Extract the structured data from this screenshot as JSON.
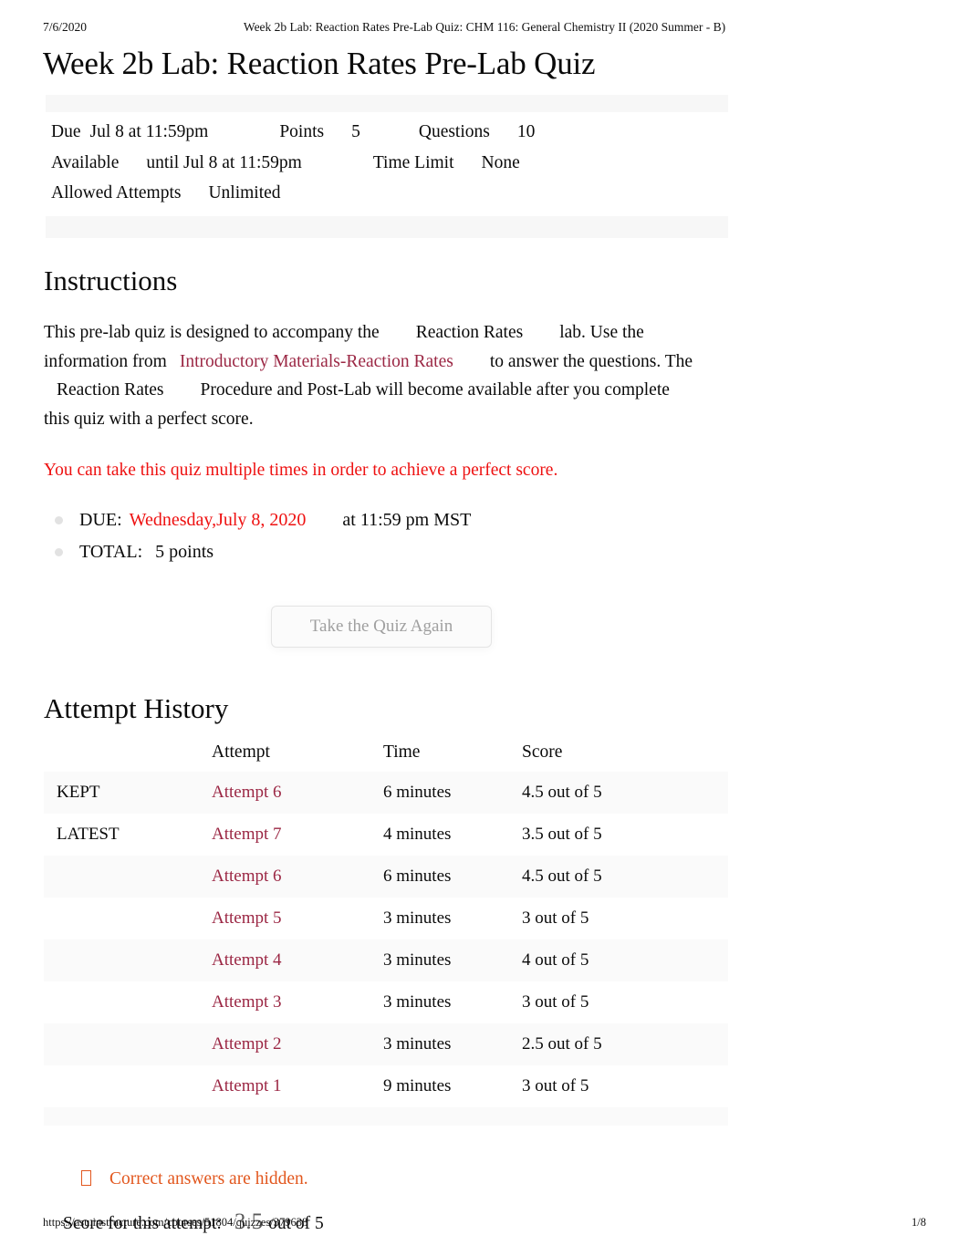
{
  "print": {
    "date": "7/6/2020",
    "header_title": "Week 2b Lab: Reaction Rates Pre-Lab Quiz: CHM 116: General Chemistry II (2020 Summer - B)",
    "url": "https://asu.instructure.com/courses/51804/quizzes/379638",
    "page_number": "1/8"
  },
  "quiz": {
    "title": "Week 2b Lab: Reaction Rates Pre-Lab Quiz",
    "meta": {
      "due_label": "Due",
      "due_value": "Jul 8 at 11:59pm",
      "points_label": "Points",
      "points_value": "5",
      "questions_label": "Questions",
      "questions_value": "10",
      "available_label": "Available",
      "available_value": "until Jul 8 at 11:59pm",
      "time_limit_label": "Time Limit",
      "time_limit_value": "None",
      "allowed_attempts_label": "Allowed Attempts",
      "allowed_attempts_value": "Unlimited"
    }
  },
  "instructions": {
    "heading": "Instructions",
    "para_part1": "This pre-lab quiz is designed to accompany the",
    "para_lab1": "Reaction Rates",
    "para_part2": "lab. Use the information from",
    "para_link": "Introductory Materials-Reaction Rates",
    "para_part3": "to answer the questions. The",
    "para_lab2": "Reaction Rates",
    "para_part4": "Procedure and Post-Lab will become available after you complete this quiz with a perfect score.",
    "red_note": "You can take this quiz multiple times in order to achieve a perfect score.",
    "bullets": [
      {
        "label": "DUE:",
        "highlight": "Wednesday,July 8, 2020",
        "tail": "at 11:59 pm MST"
      },
      {
        "label": "TOTAL:",
        "highlight": "",
        "tail": "5 points"
      }
    ]
  },
  "actions": {
    "take_quiz_again": "Take the Quiz Again"
  },
  "attempt_history": {
    "heading": "Attempt History",
    "columns": [
      "",
      "Attempt",
      "Time",
      "Score"
    ],
    "rows": [
      {
        "status": "KEPT",
        "attempt": "Attempt 6",
        "time": "6 minutes",
        "score": "4.5 out of 5"
      },
      {
        "status": "LATEST",
        "attempt": "Attempt 7",
        "time": "4 minutes",
        "score": "3.5 out of 5"
      },
      {
        "status": "",
        "attempt": "Attempt 6",
        "time": "6 minutes",
        "score": "4.5 out of 5"
      },
      {
        "status": "",
        "attempt": "Attempt 5",
        "time": "3 minutes",
        "score": "3 out of 5"
      },
      {
        "status": "",
        "attempt": "Attempt 4",
        "time": "3 minutes",
        "score": "4 out of 5"
      },
      {
        "status": "",
        "attempt": "Attempt 3",
        "time": "3 minutes",
        "score": "3 out of 5"
      },
      {
        "status": "",
        "attempt": "Attempt 2",
        "time": "3 minutes",
        "score": "2.5 out of 5"
      },
      {
        "status": "",
        "attempt": "Attempt 1",
        "time": "9 minutes",
        "score": "3 out of 5"
      }
    ]
  },
  "result": {
    "hidden_answers_note": "Correct answers are hidden.",
    "hidden_answers_icon": "missing-glyph-box",
    "score_label": "Score for this attempt:",
    "score_value": "3.5",
    "score_suffix": "out of 5"
  },
  "colors": {
    "link": "#9b2744",
    "alert_red": "#ee1111",
    "notice_orange": "#e2571e",
    "row_stripe": "#fafafa",
    "band": "#f7f7f7"
  }
}
